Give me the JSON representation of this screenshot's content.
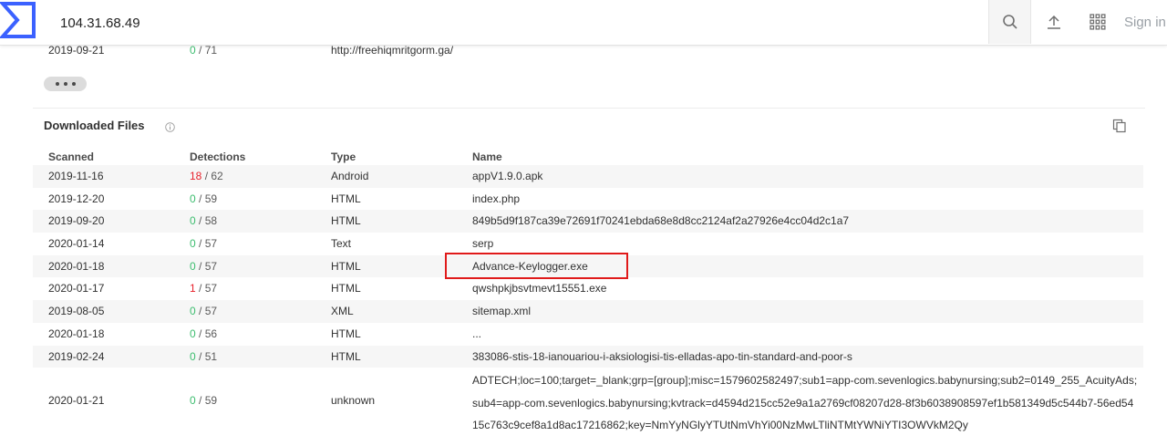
{
  "header": {
    "search_value": "104.31.68.49",
    "sign_in_label": "Sign in",
    "icons": {
      "logo": "virustotal-logo-icon",
      "search": "search-icon",
      "upload": "upload-icon",
      "apps": "apps-grid-icon"
    }
  },
  "previous_row": {
    "scanned": "2019-09-21",
    "detections_pos": "0",
    "detections_total": "/ 71",
    "url": "http://freehiqmritgorm.ga/"
  },
  "section": {
    "title": "Downloaded Files",
    "columns": {
      "scanned": "Scanned",
      "detections": "Detections",
      "type": "Type",
      "name": "Name"
    },
    "rows": [
      {
        "scanned": "2019-11-16",
        "pos": "18",
        "total": "/ 62",
        "type": "Android",
        "name": "appV1.9.0.apk"
      },
      {
        "scanned": "2019-12-20",
        "pos": "0",
        "total": "/ 59",
        "type": "HTML",
        "name": "index.php"
      },
      {
        "scanned": "2019-09-20",
        "pos": "0",
        "total": "/ 58",
        "type": "HTML",
        "name": "849b5d9f187ca39e72691f70241ebda68e8d8cc2124af2a27926e4cc04d2c1a7"
      },
      {
        "scanned": "2020-01-14",
        "pos": "0",
        "total": "/ 57",
        "type": "Text",
        "name": "serp"
      },
      {
        "scanned": "2020-01-18",
        "pos": "0",
        "total": "/ 57",
        "type": "HTML",
        "name": "Advance-Keylogger.exe"
      },
      {
        "scanned": "2020-01-17",
        "pos": "1",
        "total": "/ 57",
        "type": "HTML",
        "name": "qwshpkjbsvtmevt15551.exe"
      },
      {
        "scanned": "2019-08-05",
        "pos": "0",
        "total": "/ 57",
        "type": "XML",
        "name": "sitemap.xml"
      },
      {
        "scanned": "2020-01-18",
        "pos": "0",
        "total": "/ 56",
        "type": "HTML",
        "name": "..."
      },
      {
        "scanned": "2019-02-24",
        "pos": "0",
        "total": "/ 51",
        "type": "HTML",
        "name": "383086-stis-18-ianouariou-i-aksiologisi-tis-elladas-apo-tin-standard-and-poor-s"
      }
    ],
    "last_row": {
      "scanned": "2020-01-21",
      "pos": "0",
      "total": "/ 59",
      "type": "unknown",
      "name": "ADTECH;loc=100;target=_blank;grp=[group];misc=1579602582497;sub1=app-com.sevenlogics.babynursing;sub2=0149_255_AcuityAds;sub4=app-com.sevenlogics.babynursing;kvtrack=d4594d215cc52e9a1a2769cf08207d28-8f3b6038908597ef1b581349d5c544b7-56ed5415c763c9cef8a1d8ac17216862;key=NmYyNGlyYTUtNmVhYi00NzMwLTliNTMtYWNiYTI3OWVkM2Qy"
    }
  },
  "colors": {
    "clean": "#3dbd6f",
    "malicious": "#e8212b",
    "highlight": "#e01a1a",
    "brand": "#3b61ff"
  }
}
